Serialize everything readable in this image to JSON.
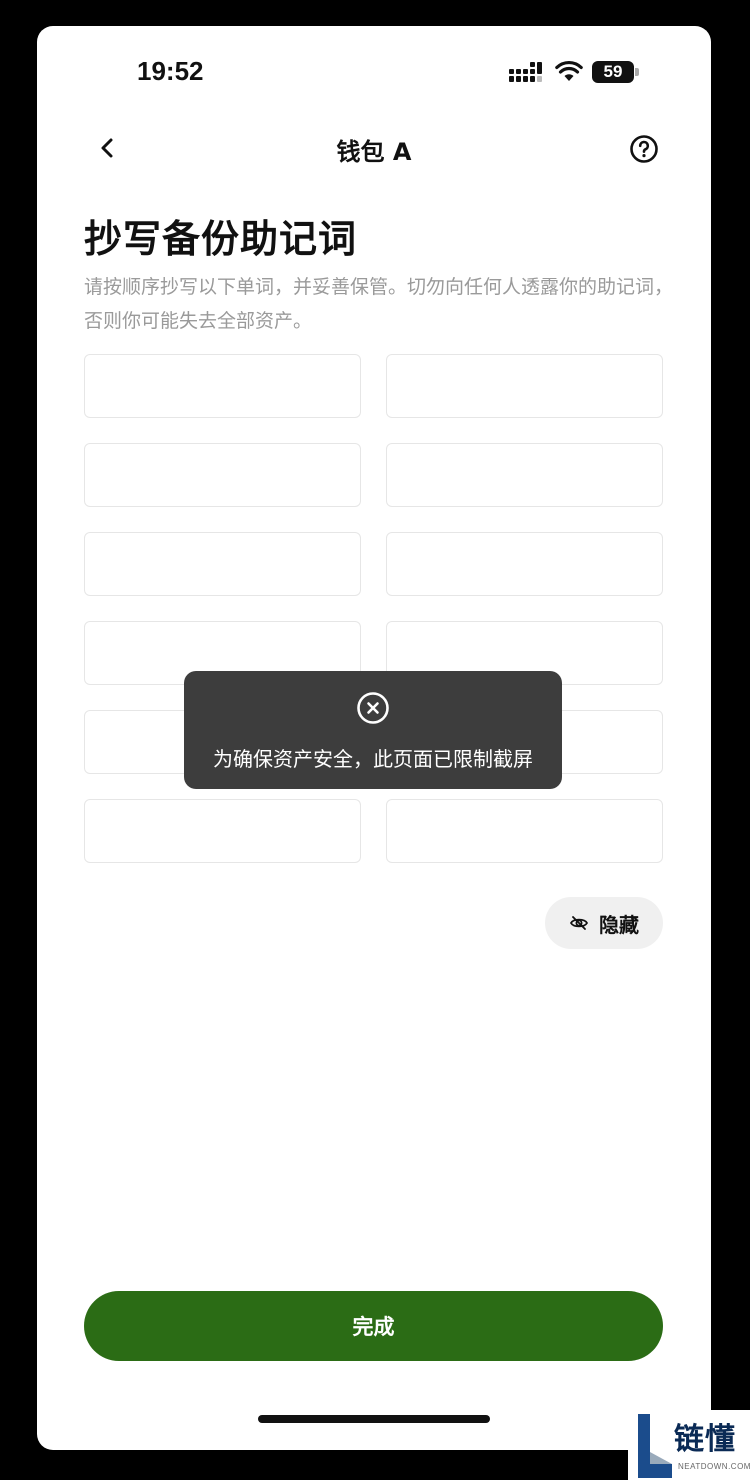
{
  "status_bar": {
    "time": "19:52",
    "battery": "59"
  },
  "nav": {
    "title": "钱包 A",
    "back_icon": "chevron-left-icon",
    "help_icon": "question-circle-icon"
  },
  "main": {
    "title": "抄写备份助记词",
    "description": "请按顺序抄写以下单词，并妥善保管。切勿向任何人透露你的助记词，否则你可能失去全部资产。",
    "word_slots": [
      "",
      "",
      "",
      "",
      "",
      "",
      "",
      "",
      "",
      "",
      "",
      ""
    ],
    "hide_button": {
      "label": "隐藏",
      "icon": "eye-off-icon"
    },
    "done_button": "完成"
  },
  "toast": {
    "icon": "close-circle-icon",
    "message": "为确保资产安全，此页面已限制截屏"
  },
  "watermark": {
    "text": "链懂",
    "sub": "NEATDOWN.COM"
  },
  "colors": {
    "primary": "#2b6c15",
    "toast_bg": "#3d3d3d",
    "description": "#9a9a9a",
    "box_border": "#e6e6e6"
  }
}
